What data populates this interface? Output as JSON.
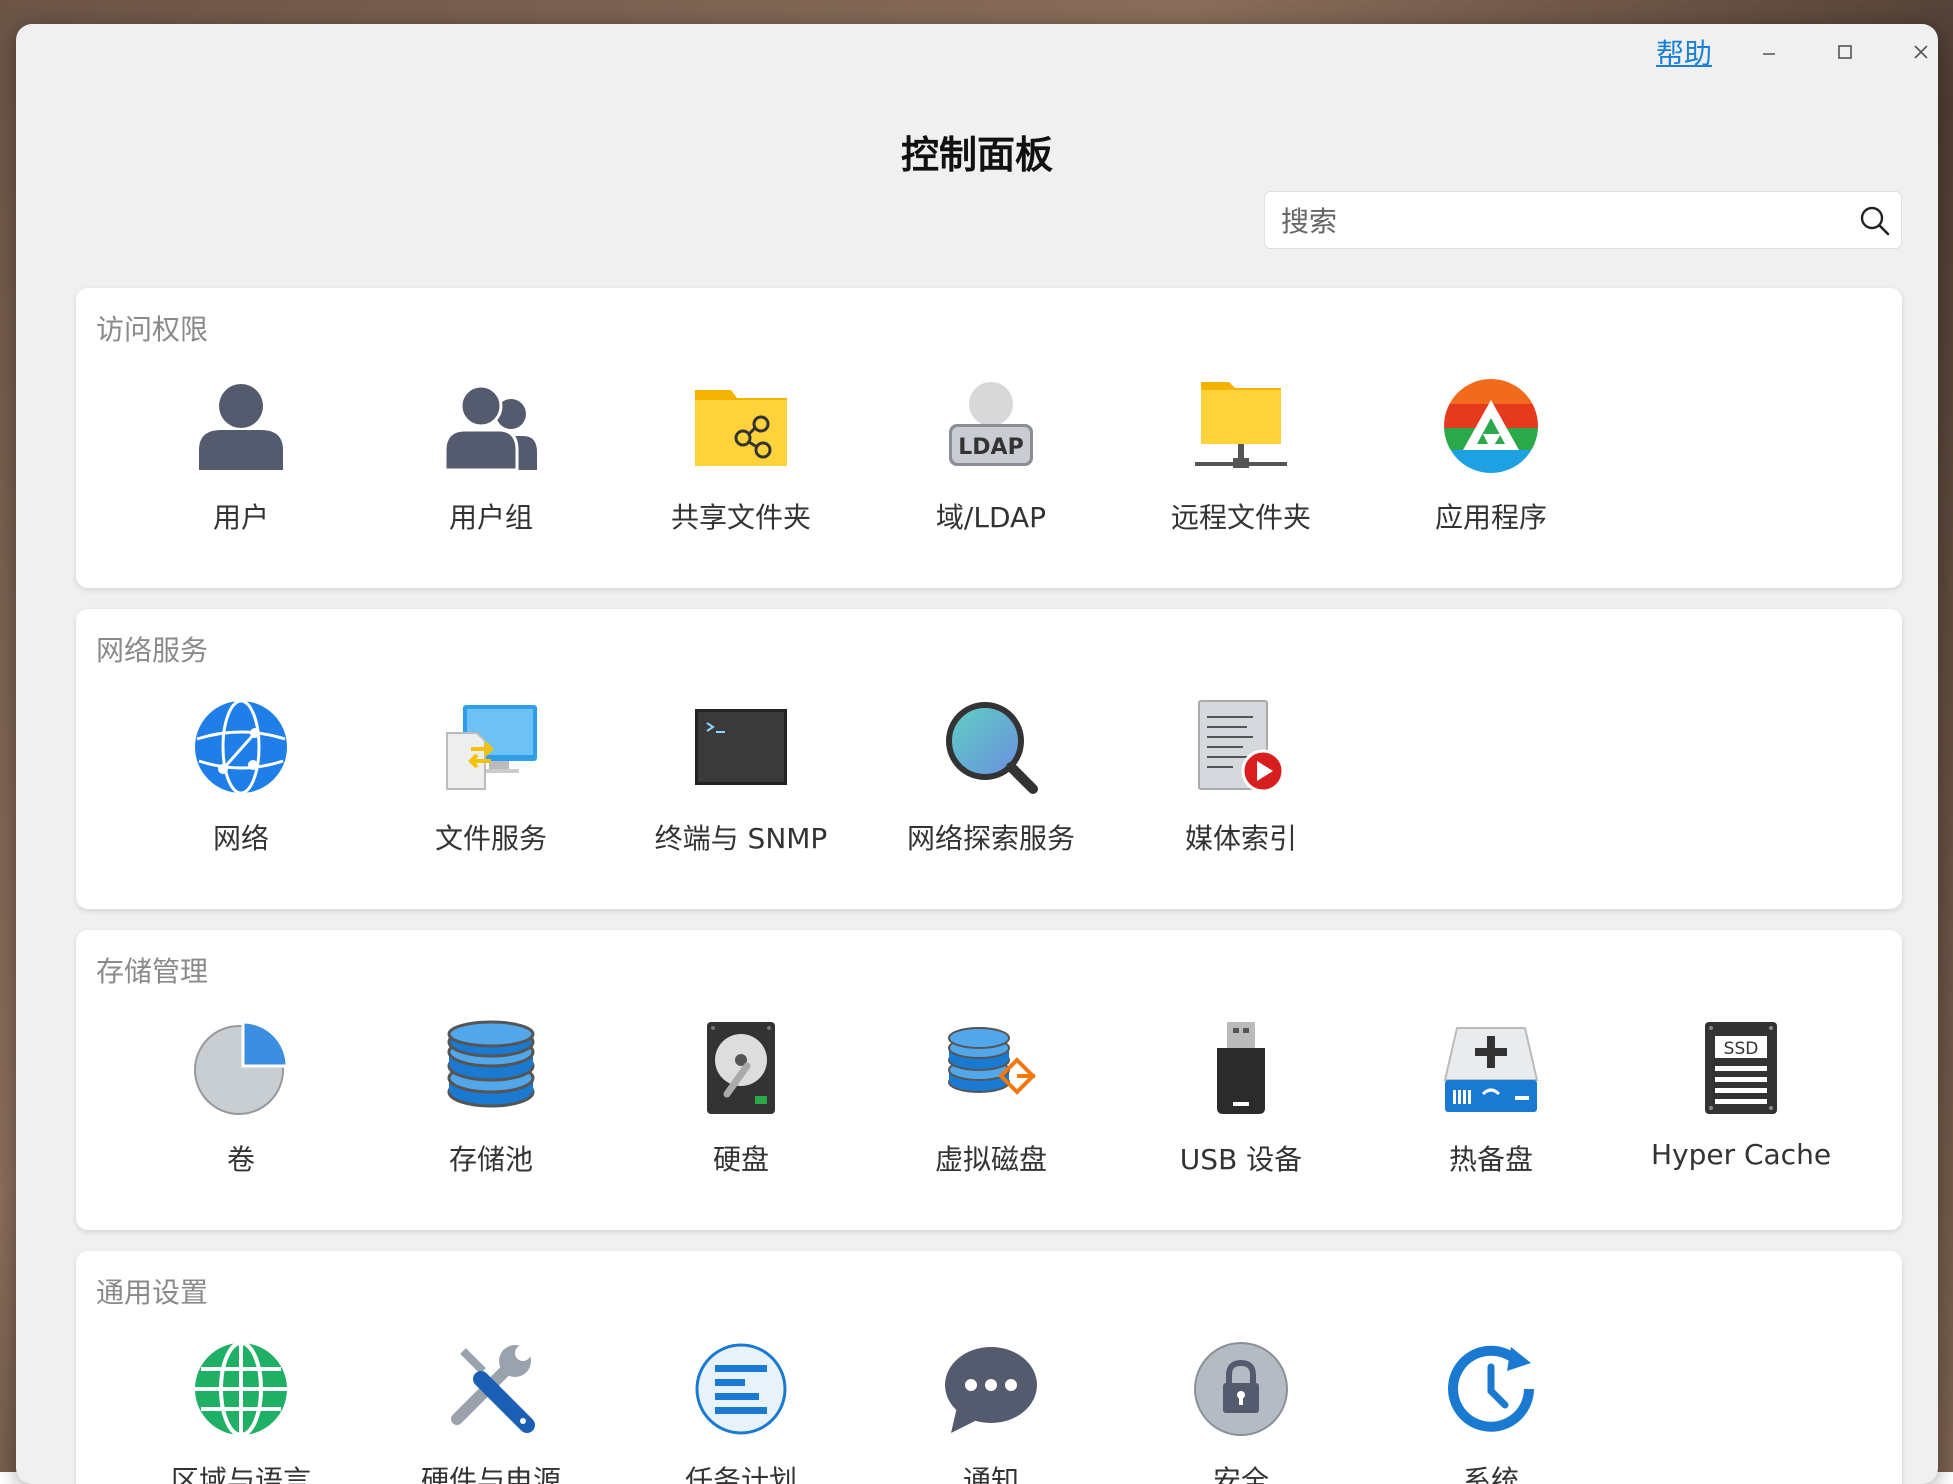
{
  "window": {
    "help_label": "帮助",
    "title": "控制面板"
  },
  "search": {
    "placeholder": "搜索"
  },
  "sections": [
    {
      "title": "访问权限",
      "items": [
        {
          "label": "用户",
          "icon": "user-icon"
        },
        {
          "label": "用户组",
          "icon": "user-group-icon"
        },
        {
          "label": "共享文件夹",
          "icon": "shared-folder-icon"
        },
        {
          "label": "域/LDAP",
          "icon": "ldap-icon"
        },
        {
          "label": "远程文件夹",
          "icon": "remote-folder-icon"
        },
        {
          "label": "应用程序",
          "icon": "application-icon"
        }
      ]
    },
    {
      "title": "网络服务",
      "items": [
        {
          "label": "网络",
          "icon": "network-globe-icon"
        },
        {
          "label": "文件服务",
          "icon": "file-service-icon"
        },
        {
          "label": "终端与 SNMP",
          "icon": "terminal-icon"
        },
        {
          "label": "网络探索服务",
          "icon": "magnifier-icon"
        },
        {
          "label": "媒体索引",
          "icon": "media-index-icon"
        }
      ]
    },
    {
      "title": "存储管理",
      "items": [
        {
          "label": "卷",
          "icon": "volume-pie-icon"
        },
        {
          "label": "存储池",
          "icon": "storage-pool-icon"
        },
        {
          "label": "硬盘",
          "icon": "hard-disk-icon"
        },
        {
          "label": "虚拟磁盘",
          "icon": "virtual-disk-icon"
        },
        {
          "label": "USB 设备",
          "icon": "usb-device-icon"
        },
        {
          "label": "热备盘",
          "icon": "hot-spare-icon"
        },
        {
          "label": "Hyper Cache",
          "icon": "ssd-cache-icon"
        }
      ]
    },
    {
      "title": "通用设置",
      "items": [
        {
          "label": "区域与语言",
          "icon": "region-globe-icon"
        },
        {
          "label": "硬件与电源",
          "icon": "tools-icon"
        },
        {
          "label": "任务计划",
          "icon": "task-schedule-icon"
        },
        {
          "label": "通知",
          "icon": "chat-bubble-icon"
        },
        {
          "label": "安全",
          "icon": "lock-icon"
        },
        {
          "label": "系统",
          "icon": "system-clock-icon"
        }
      ]
    }
  ]
}
